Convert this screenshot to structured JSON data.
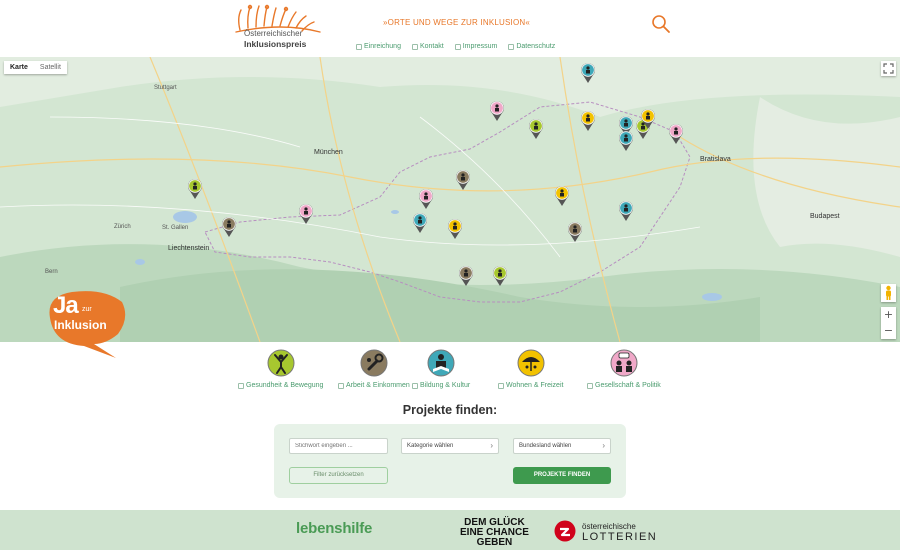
{
  "header": {
    "logo_line1": "Österreichischer",
    "logo_line2": "Inklusionspreis",
    "tagline": "»ORTE UND WEGE ZUR INKLUSION«",
    "nav": [
      {
        "label": "Einreichung"
      },
      {
        "label": "Kontakt"
      },
      {
        "label": "Impressum"
      },
      {
        "label": "Datenschutz"
      }
    ],
    "search_icon": "search-icon"
  },
  "map": {
    "type_controls": [
      {
        "label": "Karte",
        "active": true
      },
      {
        "label": "Satellit",
        "active": false
      }
    ],
    "zoom_in": "+",
    "zoom_out": "−",
    "cities": [
      {
        "name": "Stuttgart"
      },
      {
        "name": "München"
      },
      {
        "name": "Zürich"
      },
      {
        "name": "Liechtenstein"
      },
      {
        "name": "Bratislava"
      },
      {
        "name": "Budapest"
      },
      {
        "name": "Bern"
      },
      {
        "name": "St. Gallen"
      }
    ],
    "markers": [
      {
        "category": "gesundheit",
        "color": "#a7c72f"
      },
      {
        "category": "arbeit",
        "color": "#8a7b60"
      },
      {
        "category": "bildung",
        "color": "#3fa8b8"
      },
      {
        "category": "wohnen",
        "color": "#f2c200"
      },
      {
        "category": "gesellschaft",
        "color": "#f0a8c8"
      }
    ]
  },
  "badge": {
    "ja": "Ja",
    "zur": "zur",
    "inklusion": "Inklusion"
  },
  "categories": [
    {
      "label": "Gesundheit & Bewegung",
      "icon": "health-icon",
      "color": "#a7c72f"
    },
    {
      "label": "Arbeit & Einkommen",
      "icon": "work-icon",
      "color": "#8a7b60"
    },
    {
      "label": "Bildung & Kultur",
      "icon": "education-icon",
      "color": "#3fa8b8"
    },
    {
      "label": "Wohnen & Freizeit",
      "icon": "housing-icon",
      "color": "#f2c200"
    },
    {
      "label": "Gesellschaft & Politik",
      "icon": "society-icon",
      "color": "#f0a8c8"
    }
  ],
  "finder": {
    "title": "Projekte finden:",
    "keyword_placeholder": "Stichwort eingeben ...",
    "category_value": "Kategorie wählen",
    "state_value": "Bundesland wählen",
    "reset_label": "Filter zurücksetzen",
    "submit_label": "PROJEKTE FINDEN"
  },
  "footer": {
    "lebenshilfe": "lebenshilfe",
    "slogan_1": "DEM GLÜCK",
    "slogan_2": "EINE CHANCE",
    "slogan_3": "GEBEN",
    "lotterien_1": "österreichische",
    "lotterien_2": "LOTTERIEN"
  },
  "colors": {
    "accent_orange": "#e8782a",
    "link_green": "#4a9b6e",
    "button_green": "#3e9a4e",
    "map_bg": "#cfe3cf"
  }
}
